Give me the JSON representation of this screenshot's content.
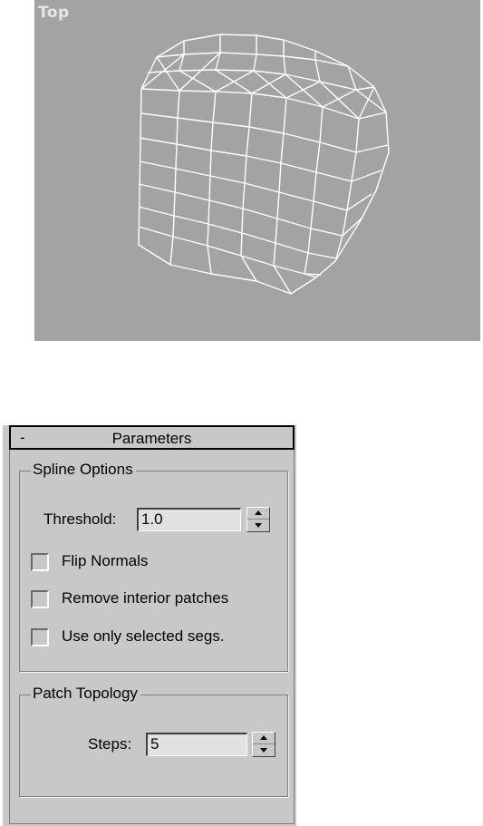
{
  "viewport": {
    "label": "Top",
    "background": "#a3a3a3",
    "wire_color": "#ffffff"
  },
  "rollout": {
    "collapse_symbol": "-",
    "title": "Parameters"
  },
  "spline_options": {
    "title": "Spline Options",
    "threshold_label": "Threshold:",
    "threshold_value": "1.0",
    "flip_normals_label": "Flip Normals",
    "flip_normals_checked": false,
    "remove_interior_label": "Remove interior patches",
    "remove_interior_checked": false,
    "use_selected_label": "Use only selected segs.",
    "use_selected_checked": false
  },
  "patch_topology": {
    "title": "Patch Topology",
    "steps_label": "Steps:",
    "steps_value": "5"
  }
}
